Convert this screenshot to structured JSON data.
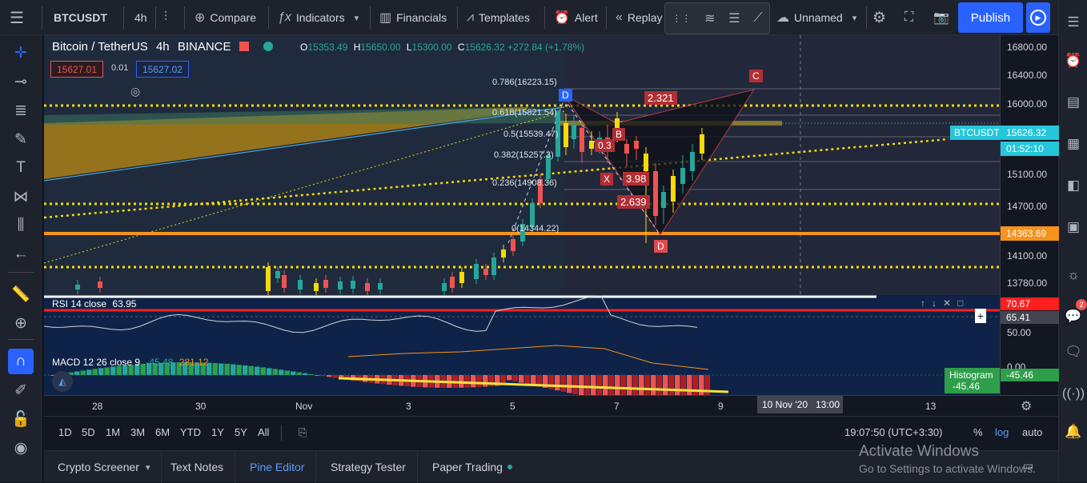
{
  "top": {
    "symbol": "BTCUSDT",
    "interval": "4h",
    "compare": "Compare",
    "indicators": "Indicators",
    "financials": "Financials",
    "templates": "Templates",
    "alert": "Alert",
    "replay": "Replay",
    "layout_name": "Unnamed",
    "publish": "Publish"
  },
  "legend": {
    "pair": "Bitcoin / TetherUS",
    "interval": "4h",
    "exchange": "BINANCE",
    "open_label": "O",
    "open": "15353.49",
    "high_label": "H",
    "high": "15650.00",
    "low_label": "L",
    "low": "15300.00",
    "close_label": "C",
    "close": "15626.32",
    "change": "+272.84 (+1.78%)",
    "sell": "15627.01",
    "spread": "0.01",
    "buy": "15627.02"
  },
  "price_axis": {
    "labels": [
      "16800.00",
      "16400.00",
      "16000.00",
      "15100.00",
      "14700.00",
      "14100.00",
      "13780.00"
    ],
    "current_symbol": "BTCUSDT",
    "current_price": "15626.32",
    "countdown": "01:52:10",
    "level": "14363.69"
  },
  "fib": [
    "0.786(16223.15)",
    "0.618(15821.54)",
    "0.5(15539.47)",
    "0.382(15257.3)",
    "0.236(14908.36)",
    "0(14344.22)"
  ],
  "pattern": {
    "points": [
      "X",
      "B",
      "C",
      "D",
      "D"
    ],
    "ratios": [
      "2.321",
      "0.3",
      "3.98",
      "2.639"
    ]
  },
  "rsi": {
    "label": "RSI 14 close",
    "value": "63.95",
    "axis_hi": "70.67",
    "axis_cur": "65.41",
    "axis_mid": "50.00"
  },
  "macd": {
    "label": "MACD 12 26 close 9",
    "v1": "-45.48",
    "v2": "281.12",
    "axis": "0.00",
    "hist_label": "Histogram",
    "hist_value": "-45.46"
  },
  "time_axis": {
    "labels": [
      "28",
      "30",
      "Nov",
      "3",
      "5",
      "7",
      "9",
      "13"
    ],
    "cursor": "10 Nov '20   13:00"
  },
  "range": {
    "buttons": [
      "1D",
      "5D",
      "1M",
      "3M",
      "6M",
      "YTD",
      "1Y",
      "5Y",
      "All"
    ],
    "clock": "19:07:50 (UTC+3:30)",
    "pct": "%",
    "log": "log",
    "auto": "auto"
  },
  "panels": [
    "Crypto Screener",
    "Text Notes",
    "Pine Editor",
    "Strategy Tester",
    "Paper Trading"
  ],
  "watermark": {
    "title": "Activate Windows",
    "subtitle": "Go to Settings to activate Windows."
  },
  "notification_count": "2",
  "colors": {
    "up": "#26a69a",
    "down": "#ef5350",
    "accent": "#2962ff",
    "fib_yellow": "#f5d90a",
    "level_orange": "#f7931a"
  }
}
